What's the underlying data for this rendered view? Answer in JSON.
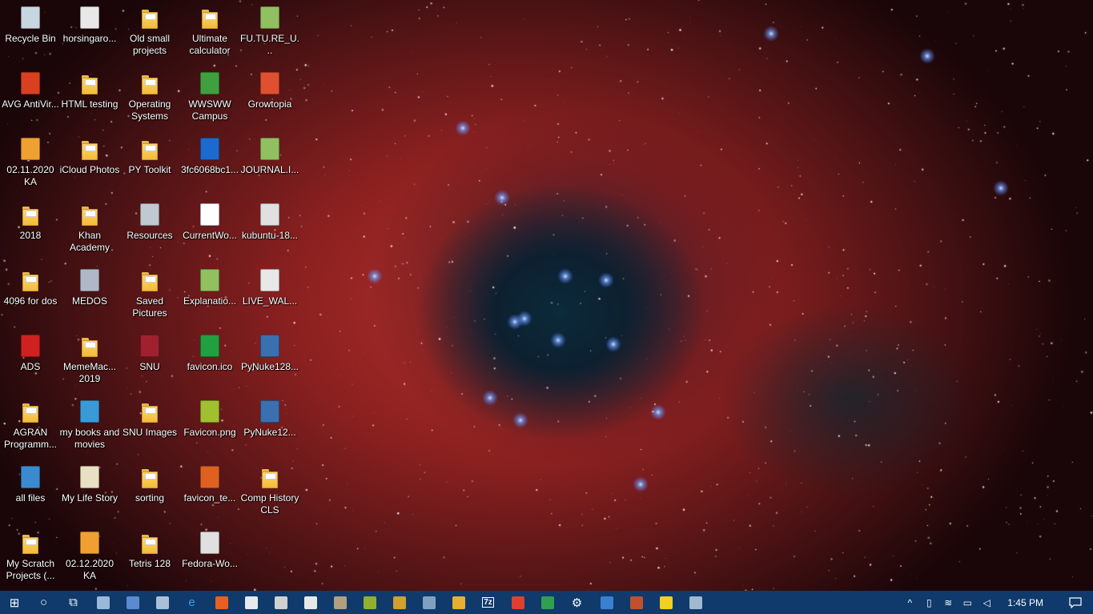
{
  "desktop": {
    "icons": [
      {
        "label": "Recycle Bin",
        "icon": "recycle-bin-icon",
        "kind": "generic",
        "color": "#c8d6e0"
      },
      {
        "label": "AVG AntiVir...",
        "icon": "avg-antivirus-icon",
        "kind": "generic",
        "color": "#d94020"
      },
      {
        "label": "02.11.2020 KA",
        "icon": "image-file-icon",
        "kind": "generic",
        "color": "#f0a030"
      },
      {
        "label": "2018",
        "icon": "folder-icon",
        "kind": "folder"
      },
      {
        "label": "4096 for dos",
        "icon": "folder-icon",
        "kind": "folder"
      },
      {
        "label": "ADS",
        "icon": "ads-app-icon",
        "kind": "generic",
        "color": "#d02020"
      },
      {
        "label": "AGRAN Programm...",
        "icon": "folder-icon",
        "kind": "folder"
      },
      {
        "label": "all files",
        "icon": "computer-monitor-icon",
        "kind": "generic",
        "color": "#3a8ad0"
      },
      {
        "label": "My Scratch Projects (...",
        "icon": "folder-icon",
        "kind": "folder"
      },
      {
        "label": "horsingaro...",
        "icon": "document-icon",
        "kind": "generic",
        "color": "#e8e8e8"
      },
      {
        "label": "HTML testing",
        "icon": "folder-icon",
        "kind": "folder"
      },
      {
        "label": "iCloud Photos",
        "icon": "folder-icon",
        "kind": "folder"
      },
      {
        "label": "Khan Academy",
        "icon": "folder-icon",
        "kind": "folder"
      },
      {
        "label": "MEDOS",
        "icon": "disc-icon",
        "kind": "generic",
        "color": "#b0b8c8"
      },
      {
        "label": "MemeMac... 2019",
        "icon": "folder-icon",
        "kind": "folder"
      },
      {
        "label": "my books and movies",
        "icon": "media-player-icon",
        "kind": "generic",
        "color": "#3a9ad8"
      },
      {
        "label": "My Life Story",
        "icon": "calendar-app-icon",
        "kind": "generic",
        "color": "#e8e0c0"
      },
      {
        "label": "02.12.2020 KA",
        "icon": "image-file-icon",
        "kind": "generic",
        "color": "#f0a030"
      },
      {
        "label": "Old small projects",
        "icon": "folder-icon",
        "kind": "folder"
      },
      {
        "label": "Operating Systems",
        "icon": "folder-icon",
        "kind": "folder"
      },
      {
        "label": "PY Toolkit",
        "icon": "folder-icon",
        "kind": "folder"
      },
      {
        "label": "Resources",
        "icon": "drive-icon",
        "kind": "generic",
        "color": "#c0c8d0"
      },
      {
        "label": "Saved Pictures",
        "icon": "folder-icon",
        "kind": "folder"
      },
      {
        "label": "SNU",
        "icon": "archive-icon",
        "kind": "generic",
        "color": "#a02030"
      },
      {
        "label": "SNU Images",
        "icon": "folder-icon",
        "kind": "folder"
      },
      {
        "label": "sorting",
        "icon": "folder-icon",
        "kind": "folder"
      },
      {
        "label": "Tetris 128",
        "icon": "folder-icon",
        "kind": "folder"
      },
      {
        "label": "Ultimate calculator",
        "icon": "folder-icon",
        "kind": "folder"
      },
      {
        "label": "WWSWW Campus",
        "icon": "globe-icon",
        "kind": "generic",
        "color": "#40a040"
      },
      {
        "label": "3fc6068bc1...",
        "icon": "instagram-icon",
        "kind": "generic",
        "color": "#1a6ad0"
      },
      {
        "label": "CurrentWo...",
        "icon": "text-file-icon",
        "kind": "generic",
        "color": "#ffffff"
      },
      {
        "label": "Explanatio...",
        "icon": "notepadpp-file-icon",
        "kind": "generic",
        "color": "#90c060"
      },
      {
        "label": "favicon.ico",
        "icon": "favicon-ico-icon",
        "kind": "generic",
        "color": "#20a040"
      },
      {
        "label": "Favicon.png",
        "icon": "favicon-png-icon",
        "kind": "generic",
        "color": "#a0c030"
      },
      {
        "label": "favicon_te...",
        "icon": "firefox-html-icon",
        "kind": "generic",
        "color": "#e06020"
      },
      {
        "label": "Fedora-Wo...",
        "icon": "disc-image-icon",
        "kind": "generic",
        "color": "#e0e0e0"
      },
      {
        "label": "FU.TU.RE_U...",
        "icon": "notepadpp-file-icon",
        "kind": "generic",
        "color": "#90c060"
      },
      {
        "label": "Growtopia",
        "icon": "growtopia-icon",
        "kind": "generic",
        "color": "#e05030"
      },
      {
        "label": "JOURNAL.I...",
        "icon": "notepadpp-file-icon",
        "kind": "generic",
        "color": "#90c060"
      },
      {
        "label": "kubuntu-18...",
        "icon": "disc-image-icon",
        "kind": "generic",
        "color": "#e0e0e0"
      },
      {
        "label": "LIVE_WAL...",
        "icon": "shortcut-file-icon",
        "kind": "generic",
        "color": "#e8e8e8"
      },
      {
        "label": "PyNuke128...",
        "icon": "python-file-icon",
        "kind": "generic",
        "color": "#3a70b0"
      },
      {
        "label": "PyNuke12...",
        "icon": "python-file-icon",
        "kind": "generic",
        "color": "#3a70b0"
      },
      {
        "label": "Comp History CLS",
        "icon": "folder-icon",
        "kind": "folder"
      }
    ]
  },
  "taskbar": {
    "background": "#0f3a6b",
    "items": [
      {
        "icon": "windows-start-icon",
        "glyph": "⊞",
        "color": "#ffffff"
      },
      {
        "icon": "cortana-search-icon",
        "glyph": "○",
        "color": "#ffffff"
      },
      {
        "icon": "task-view-icon",
        "glyph": "⧉",
        "color": "#ffffff"
      },
      {
        "icon": "this-pc-icon",
        "glyph": "",
        "color": "#9ab8d8"
      },
      {
        "icon": "control-panel-icon",
        "glyph": "",
        "color": "#5a8ad0"
      },
      {
        "icon": "cloud-drive-icon",
        "glyph": "",
        "color": "#a8c0d8"
      },
      {
        "icon": "edge-browser-icon",
        "glyph": "e",
        "color": "#3a9ae8"
      },
      {
        "icon": "firefox-icon",
        "glyph": "",
        "color": "#e86020"
      },
      {
        "icon": "notepad-icon",
        "glyph": "",
        "color": "#e8e8f0"
      },
      {
        "icon": "game-controller-icon",
        "glyph": "",
        "color": "#d0d0d0"
      },
      {
        "icon": "media-app-icon",
        "glyph": "",
        "color": "#e8e8e8"
      },
      {
        "icon": "gimp-icon",
        "glyph": "",
        "color": "#b0a080"
      },
      {
        "icon": "green-app-icon",
        "glyph": "",
        "color": "#90b030"
      },
      {
        "icon": "spreadsheet-icon",
        "glyph": "",
        "color": "#d0a030"
      },
      {
        "icon": "network-app-icon",
        "glyph": "",
        "color": "#80a0c0"
      },
      {
        "icon": "folder-app-icon",
        "glyph": "",
        "color": "#e8b030"
      },
      {
        "icon": "7zip-icon",
        "glyph": "7z",
        "color": "#ffffff"
      },
      {
        "icon": "paint-icon",
        "glyph": "",
        "color": "#e04030"
      },
      {
        "icon": "colorful-app-icon",
        "glyph": "",
        "color": "#30a050"
      },
      {
        "icon": "settings-gear-icon",
        "glyph": "⚙",
        "color": "#ffffff"
      },
      {
        "icon": "bookmark-app-icon",
        "glyph": "",
        "color": "#3a80d0"
      },
      {
        "icon": "winrar-icon",
        "glyph": "",
        "color": "#c05030"
      },
      {
        "icon": "sticky-notes-icon",
        "glyph": "",
        "color": "#f0d020"
      },
      {
        "icon": "remote-desktop-icon",
        "glyph": "",
        "color": "#a0b8d0"
      }
    ],
    "tray": [
      {
        "icon": "chevron-up-icon",
        "glyph": "^"
      },
      {
        "icon": "tablet-icon",
        "glyph": "▯"
      },
      {
        "icon": "wifi-icon",
        "glyph": "≋"
      },
      {
        "icon": "battery-icon",
        "glyph": "▭"
      },
      {
        "icon": "volume-icon",
        "glyph": "◁"
      }
    ],
    "clock": "1:45 PM",
    "notification_icon": "action-center-icon"
  }
}
